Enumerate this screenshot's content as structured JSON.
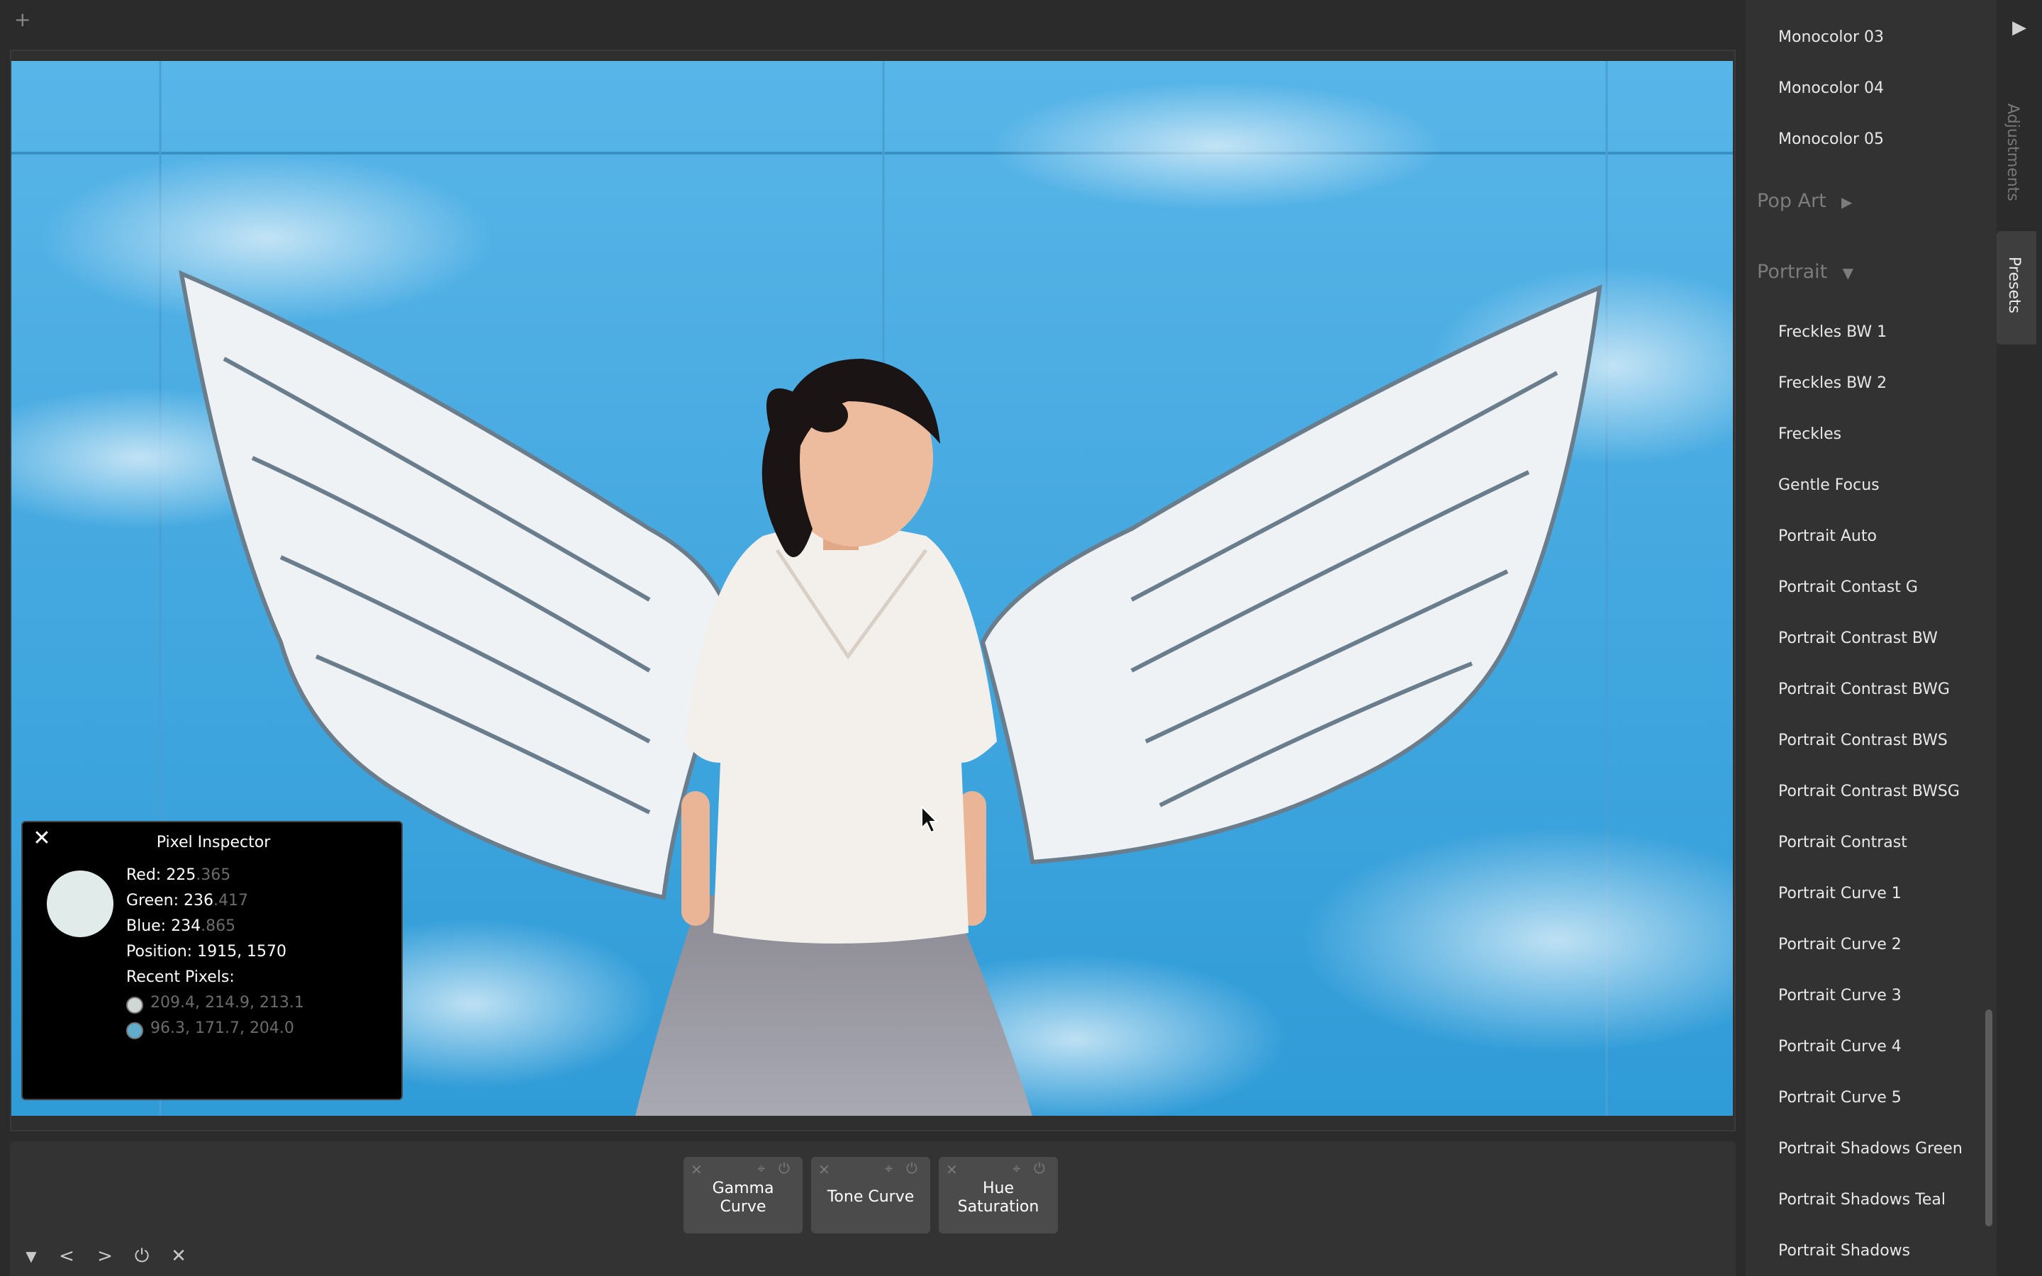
{
  "toolbar": {
    "add_symbol": "+"
  },
  "image": {
    "description_colors": {
      "sky": "#3aa3dd",
      "cloud": "#bfe1f3",
      "wing": "#eef2f4",
      "wing_shade": "#5d7283",
      "dress": "#f2efec",
      "skirt": "#8a8890",
      "hair": "#1a1414",
      "skin": "#e9b596"
    }
  },
  "pixel_inspector": {
    "title": "Pixel Inspector",
    "close_symbol": "✕",
    "swatch_color": "#e1ecea",
    "red_label": "Red:",
    "red_int": "225",
    "red_frac": ".365",
    "green_label": "Green:",
    "green_int": "236",
    "green_frac": ".417",
    "blue_label": "Blue:",
    "blue_int": "234",
    "blue_frac": ".865",
    "position_label": "Position:",
    "position_value": "1915, 1570",
    "recent_label": "Recent Pixels:",
    "recent": [
      {
        "value": "209.4, 214.9, 213.1",
        "color": "#d1d7d5"
      },
      {
        "value": "96.3, 171.7, 204.0",
        "color": "#60accc"
      }
    ]
  },
  "adjustments_stack": [
    {
      "line1": "Gamma",
      "line2": "Curve"
    },
    {
      "line1": "Tone Curve",
      "line2": ""
    },
    {
      "line1": "Hue",
      "line2": "Saturation"
    }
  ],
  "adjustment_icons": {
    "close": "✕",
    "pin": "📌",
    "power": "⏻"
  },
  "bottom_controls": {
    "collapse": "▼",
    "prev": "<",
    "next": ">",
    "power": "⏻",
    "close": "✕"
  },
  "presets": {
    "mono_items": [
      "Monocolor 03",
      "Monocolor 04",
      "Monocolor 05"
    ],
    "group_popart": "Pop Art",
    "group_portrait": "Portrait",
    "portrait_items": [
      "Freckles BW 1",
      "Freckles BW 2",
      "Freckles",
      "Gentle Focus",
      "Portrait Auto",
      "Portrait Contast G",
      "Portrait Contrast BW",
      "Portrait Contrast BWG",
      "Portrait Contrast BWS",
      "Portrait Contrast BWSG",
      "Portrait Contrast",
      "Portrait Curve 1",
      "Portrait Curve 2",
      "Portrait Curve 3",
      "Portrait Curve 4",
      "Portrait Curve 5",
      "Portrait Shadows Green",
      "Portrait Shadows Teal",
      "Portrait Shadows"
    ]
  },
  "side_tabs": {
    "play": "▶",
    "adjustments": "Adjustments",
    "presets": "Presets"
  }
}
